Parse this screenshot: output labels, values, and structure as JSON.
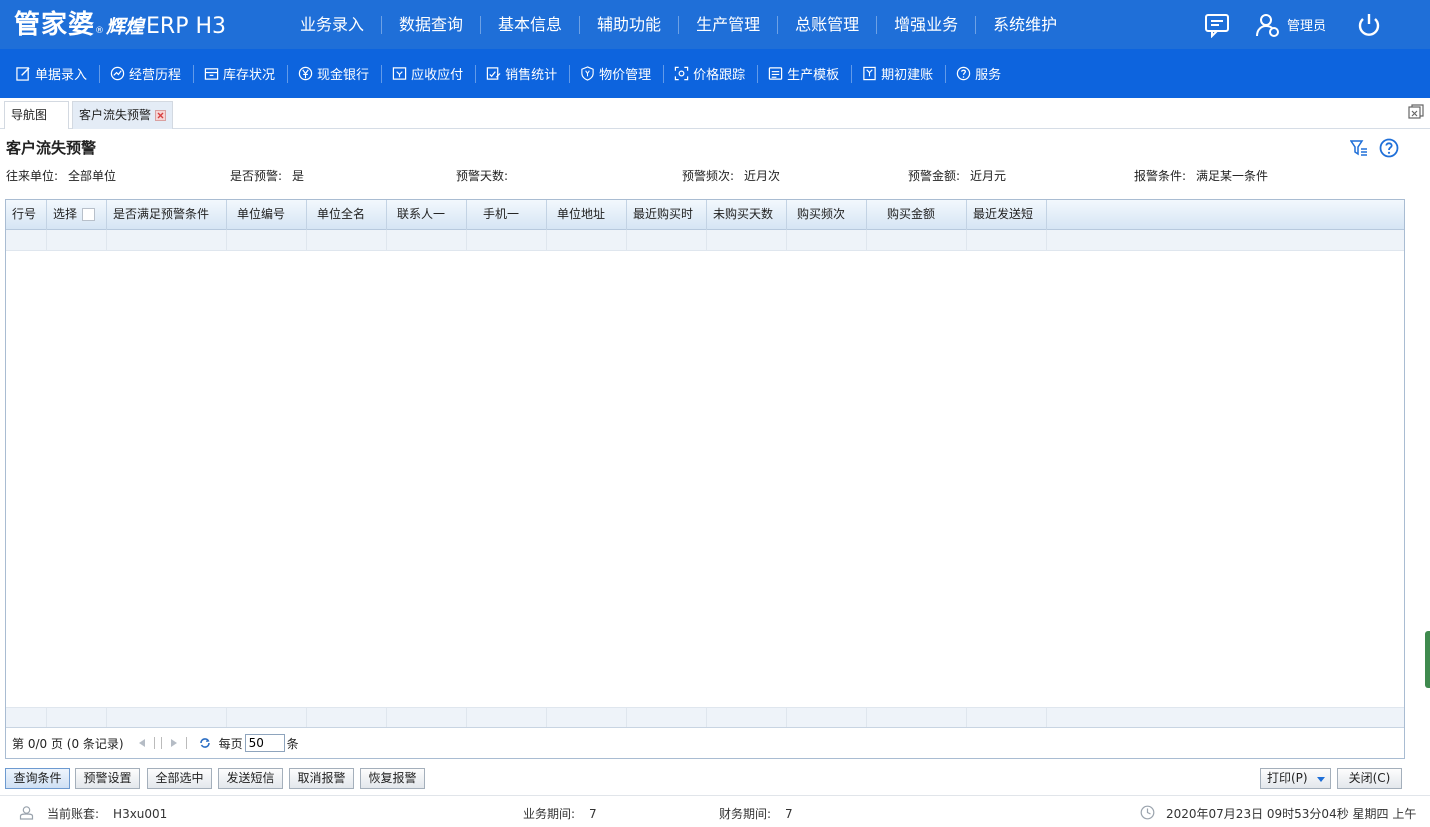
{
  "header": {
    "logo_main": "管家婆",
    "logo_reg": "®",
    "logo_series": "辉煌",
    "logo_product": "ERP H3",
    "nav": [
      "业务录入",
      "数据查询",
      "基本信息",
      "辅助功能",
      "生产管理",
      "总账管理",
      "增强业务",
      "系统维护"
    ],
    "user_name": "管理员",
    "icons": {
      "message": "message-icon",
      "user": "user-icon",
      "power": "power-icon"
    }
  },
  "toolbar": {
    "items": [
      {
        "label": "单据录入",
        "icon": "edit-icon"
      },
      {
        "label": "经营历程",
        "icon": "trend-icon"
      },
      {
        "label": "库存状况",
        "icon": "inventory-icon"
      },
      {
        "label": "现金银行",
        "icon": "yuan-icon"
      },
      {
        "label": "应收应付",
        "icon": "invoice-icon"
      },
      {
        "label": "销售统计",
        "icon": "stats-icon"
      },
      {
        "label": "物价管理",
        "icon": "shield-yuan-icon"
      },
      {
        "label": "价格跟踪",
        "icon": "track-icon"
      },
      {
        "label": "生产模板",
        "icon": "template-icon"
      },
      {
        "label": "期初建账",
        "icon": "ledger-icon"
      },
      {
        "label": "服务",
        "icon": "help-circle-icon"
      }
    ]
  },
  "tabs": {
    "nav": "导航图",
    "active": "客户流失预警"
  },
  "page": {
    "title": "客户流失预警"
  },
  "criteria": [
    {
      "label": "往来单位:",
      "value": "全部单位"
    },
    {
      "label": "是否预警:",
      "value": "是"
    },
    {
      "label": "预警天数:",
      "value": ""
    },
    {
      "label": "预警频次:",
      "value": "近月次"
    },
    {
      "label": "预警金额:",
      "value": "近月元"
    },
    {
      "label": "报警条件:",
      "value": "满足某一条件"
    }
  ],
  "grid": {
    "columns": [
      "行号",
      "选择",
      "是否满足预警条件",
      "单位编号",
      "单位全名",
      "联系人一",
      "手机一",
      "单位地址",
      "最近购买时",
      "未购买天数",
      "购买频次",
      "购买金额",
      "最近发送短"
    ]
  },
  "pager": {
    "info": "第 0/0 页 (0 条记录)",
    "per_page_label": "每页",
    "per_page_value": "50",
    "unit": "条"
  },
  "buttons": {
    "query": "查询条件",
    "warn_settings": "预警设置",
    "select_all": "全部选中",
    "send_sms": "发送短信",
    "cancel_alarm": "取消报警",
    "restore_alarm": "恢复报警",
    "print": "打印(P)",
    "close": "关闭(C)"
  },
  "status": {
    "account_label": "当前账套:",
    "account_value": "H3xu001",
    "biz_period_label": "业务期间:",
    "biz_period_value": "7",
    "fin_period_label": "财务期间:",
    "fin_period_value": "7",
    "datetime": "2020年07月23日 09时53分04秒 星期四 上午"
  },
  "colors": {
    "topbar": "#1f6fd8",
    "subbar": "#0d64de",
    "grid_header": "#d6e5f4",
    "accent": "#1f6fd8"
  }
}
